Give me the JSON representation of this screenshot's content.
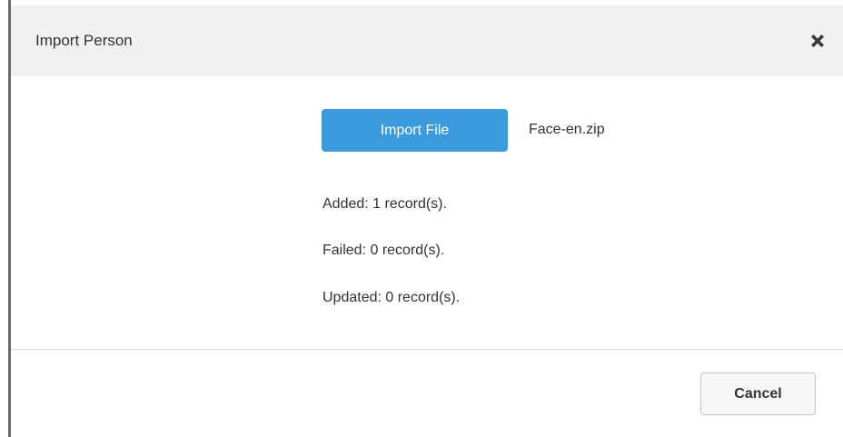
{
  "dialog": {
    "title": "Import Person",
    "close_icon": "close-x-icon"
  },
  "import": {
    "button_label": "Import File",
    "file_name": "Face-en.zip"
  },
  "results": {
    "added": "Added: 1 record(s).",
    "failed": "Failed: 0 record(s).",
    "updated": "Updated: 0 record(s)."
  },
  "footer": {
    "cancel_label": "Cancel"
  },
  "colors": {
    "primary_button": "#3c9ade",
    "header_background": "#f1f1f1",
    "left_border": "#6b6b6b"
  }
}
